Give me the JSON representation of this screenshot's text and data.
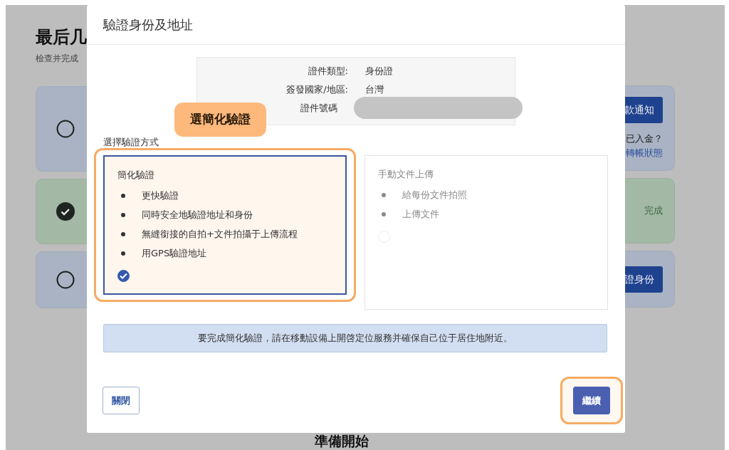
{
  "background_page": {
    "title": "最后几",
    "subtitle": "檢查并完成",
    "steps": [
      {
        "done": false,
        "button": "款通知",
        "note": "已入金？",
        "link": "轉帳狀態"
      },
      {
        "done": true,
        "status": "完成"
      },
      {
        "done": false,
        "button": "證身份"
      }
    ],
    "footer_heading": "準備開始"
  },
  "modal": {
    "title": "驗證身份及地址",
    "document": [
      {
        "label": "證件類型:",
        "value": "身份證"
      },
      {
        "label": "簽發國家/地區:",
        "value": "台灣"
      },
      {
        "label": "證件號碼",
        "redacted": true
      }
    ],
    "annotation": "選簡化驗證",
    "section_label": "選擇驗證方式",
    "options": [
      {
        "title": "簡化驗證",
        "bullets": [
          "更快驗證",
          "同時安全地驗證地址和身份",
          "無縫銜接的自拍+文件拍攝于上傳流程",
          "用GPS驗證地址"
        ],
        "selected": true,
        "highlighted": true
      },
      {
        "title": "手動文件上傳",
        "bullets": [
          "給每份文件拍照",
          "上傳文件"
        ],
        "selected": false,
        "highlighted": false
      }
    ],
    "notice": "要完成簡化驗證，請在移動設備上開啓定位服務并確保自己位于居住地附近。",
    "buttons": [
      {
        "label": "關閉",
        "kind": "secondary",
        "highlighted": false
      },
      {
        "label": "繼續",
        "kind": "primary",
        "highlighted": true
      }
    ]
  }
}
